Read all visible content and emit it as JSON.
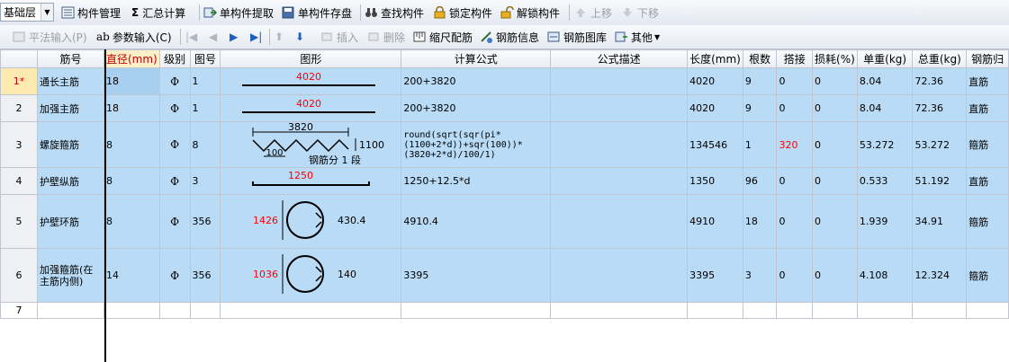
{
  "toolbar1": {
    "level_select": "基础层",
    "component_manage": "构件管理",
    "summary_calc": "汇总计算",
    "single_extract": "单构件提取",
    "single_save": "单构件存盘",
    "find_component": "查找构件",
    "lock_component": "锁定构件",
    "unlock_component": "解锁构件",
    "move_up": "上移",
    "move_down": "下移"
  },
  "toolbar2": {
    "flat_input": "平法输入(P)",
    "param_input": "参数输入(C)",
    "insert": "插入",
    "delete": "删除",
    "scale_rebar": "缩尺配筋",
    "rebar_info": "钢筋信息",
    "rebar_library": "钢筋图库",
    "other": "其他"
  },
  "table": {
    "headers": [
      "筋号",
      "直径(mm)",
      "级别",
      "图号",
      "图形",
      "计算公式",
      "公式描述",
      "长度(mm)",
      "根数",
      "搭接",
      "损耗(%)",
      "单重(kg)",
      "总重(kg)",
      "钢筋归"
    ],
    "rows": [
      {
        "num": "1*",
        "name": "通长主筋",
        "dia": "18",
        "grade": "Ф",
        "fig": "1",
        "formula": "200+3820",
        "desc": "",
        "length": "4020",
        "count": "9",
        "lap": "0",
        "loss": "0",
        "unit_w": "8.04",
        "total_w": "72.36",
        "type": "直筋",
        "shape": {
          "len": "4020"
        }
      },
      {
        "num": "2",
        "name": "加强主筋",
        "dia": "18",
        "grade": "Ф",
        "fig": "1",
        "formula": "200+3820",
        "desc": "",
        "length": "4020",
        "count": "9",
        "lap": "0",
        "loss": "0",
        "unit_w": "8.04",
        "total_w": "72.36",
        "type": "直筋",
        "shape": {
          "len": "4020"
        }
      },
      {
        "num": "3",
        "name": "螺旋箍筋",
        "dia": "8",
        "grade": "Ф",
        "fig": "8",
        "formula": "round(sqrt(sqr(pi*(1100+2*d))+sqr(100))*(3820+2*d)/100/1)",
        "desc": "",
        "length": "134546",
        "count": "1",
        "lap": "320",
        "loss": "0",
        "unit_w": "53.272",
        "total_w": "53.272",
        "type": "箍筋",
        "shape": {
          "top": "3820",
          "pitch": "100",
          "height": "1100",
          "note": "钢筋分 1 段"
        }
      },
      {
        "num": "4",
        "name": "护壁纵筋",
        "dia": "8",
        "grade": "Ф",
        "fig": "3",
        "formula": "1250+12.5*d",
        "desc": "",
        "length": "1350",
        "count": "96",
        "lap": "0",
        "loss": "0",
        "unit_w": "0.533",
        "total_w": "51.192",
        "type": "直筋",
        "shape": {
          "len": "1250"
        }
      },
      {
        "num": "5",
        "name": "护壁环筋",
        "dia": "8",
        "grade": "Ф",
        "fig": "356",
        "formula": "4910.4",
        "desc": "",
        "length": "4910",
        "count": "18",
        "lap": "0",
        "loss": "0",
        "unit_w": "1.939",
        "total_w": "34.91",
        "type": "箍筋",
        "shape": {
          "left": "1426",
          "right": "430.4"
        }
      },
      {
        "num": "6",
        "name": "加强箍筋(在主筋内侧)",
        "dia": "14",
        "grade": "Ф",
        "fig": "356",
        "formula": "3395",
        "desc": "",
        "length": "3395",
        "count": "3",
        "lap": "0",
        "loss": "0",
        "unit_w": "4.108",
        "total_w": "12.324",
        "type": "箍筋",
        "shape": {
          "left": "1036",
          "right": "140"
        }
      },
      {
        "num": "7"
      }
    ]
  },
  "colors": {
    "row_bg": "#b9dbf6",
    "highlight_header": "#fdf0c8",
    "red_text": "#ff0000"
  }
}
